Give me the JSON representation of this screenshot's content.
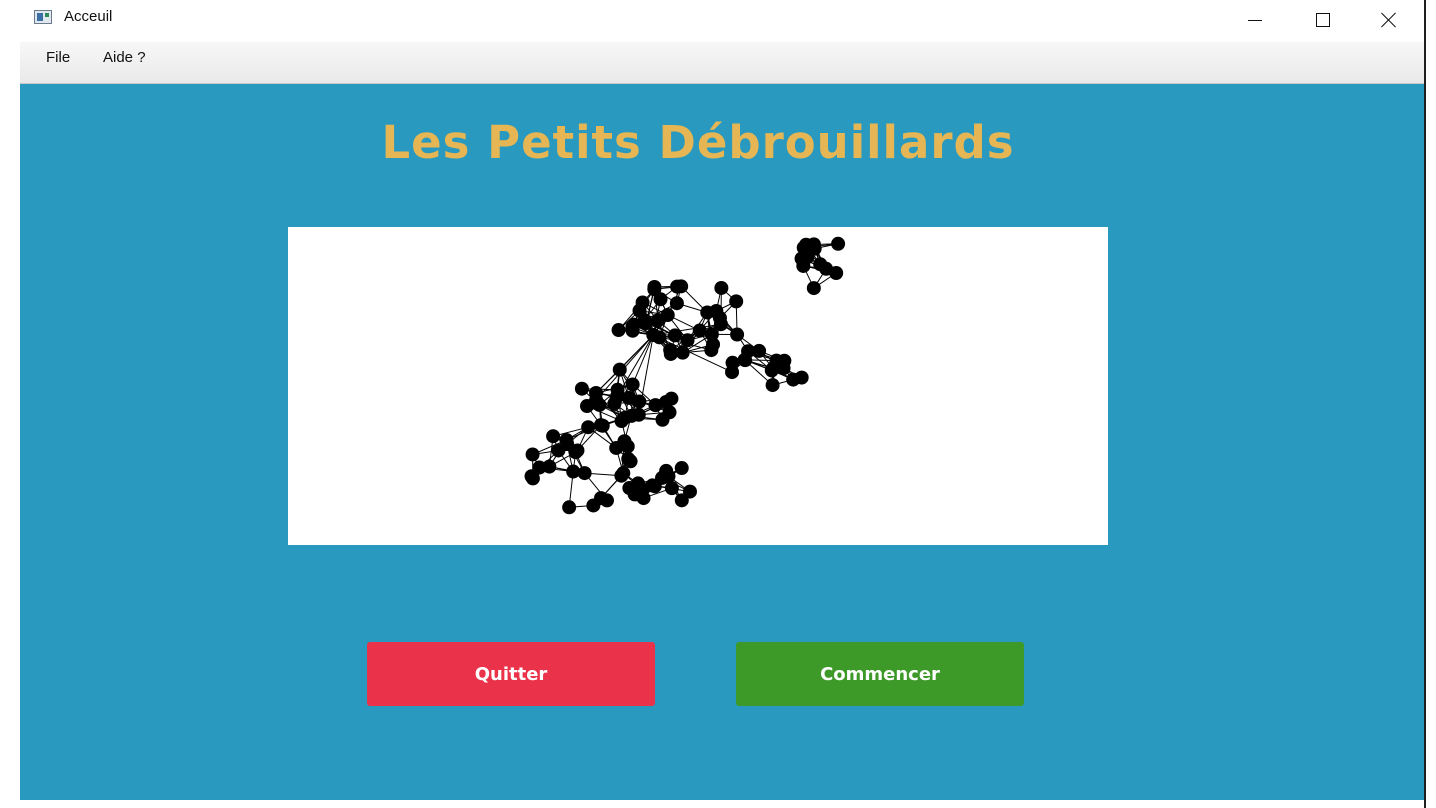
{
  "window": {
    "title": "Acceuil",
    "controls": [
      "minimize-icon",
      "maximize-icon",
      "close-icon"
    ]
  },
  "menu": {
    "items": [
      {
        "label": "File"
      },
      {
        "label": "Aide ?"
      }
    ]
  },
  "main": {
    "heading": "Les Petits Débrouillards",
    "background_color": "#2999bf",
    "heading_color": "#e5b653",
    "graph_image": "network-graph-illustration"
  },
  "buttons": {
    "quit": {
      "label": "Quitter",
      "color": "#ea334a"
    },
    "start": {
      "label": "Commencer",
      "color": "#3e9a28"
    }
  }
}
